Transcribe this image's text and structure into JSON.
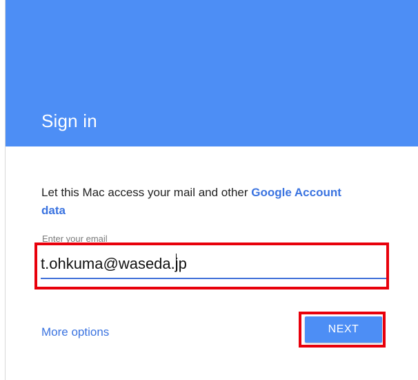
{
  "header": {
    "title": "Sign in"
  },
  "main": {
    "prompt_text": "Let this Mac access your mail and other ",
    "prompt_link": "Google Account",
    "prompt_text_end": "data",
    "email": {
      "label": "Enter your email",
      "value": "t.ohkuma@waseda.jp"
    },
    "more_options_label": "More options",
    "next_label": "NEXT"
  },
  "colors": {
    "header_bg": "#4d8ef5",
    "link": "#3a73e0",
    "highlight": "#e8000b",
    "button_bg": "#4d8ef5"
  }
}
